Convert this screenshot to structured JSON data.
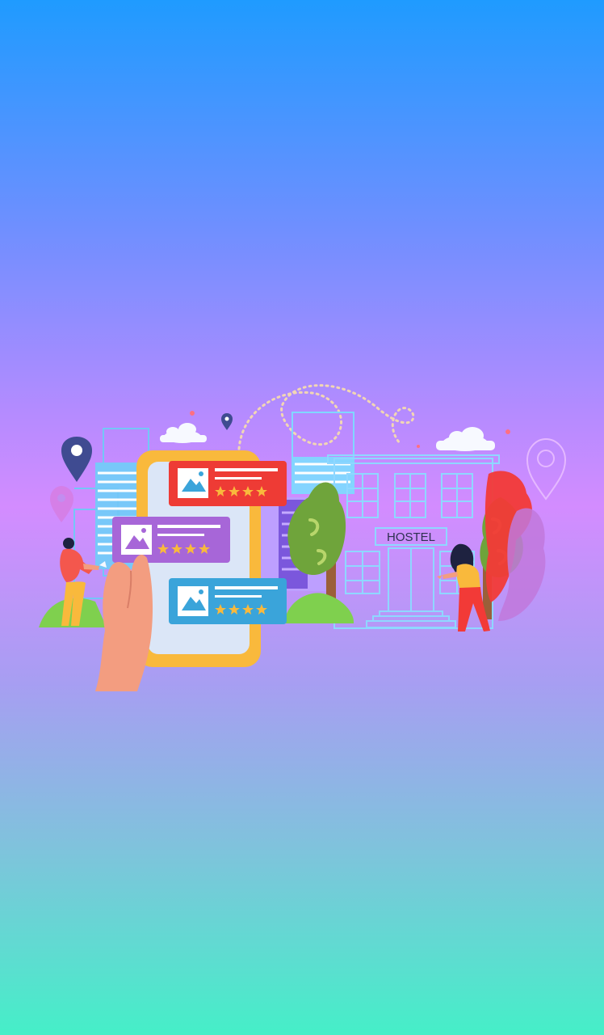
{
  "splash": {
    "illustration": {
      "sign_text": "HOSTEL",
      "review_cards": [
        {
          "color": "#ee3b35",
          "stars": 4
        },
        {
          "color": "#a766d8",
          "stars": 4
        },
        {
          "color": "#3aa4da",
          "stars": 4
        }
      ],
      "icons": [
        "location-pin-icon",
        "image-placeholder-icon",
        "star-icon",
        "cloud-icon"
      ]
    },
    "colors": {
      "gradient_top": "#1f9bff",
      "gradient_middle": "#d38cff",
      "gradient_bottom": "#45efc8",
      "phone_frame": "#f9b93c",
      "tree": "#6fa43b",
      "star": "#f9b93c"
    }
  }
}
